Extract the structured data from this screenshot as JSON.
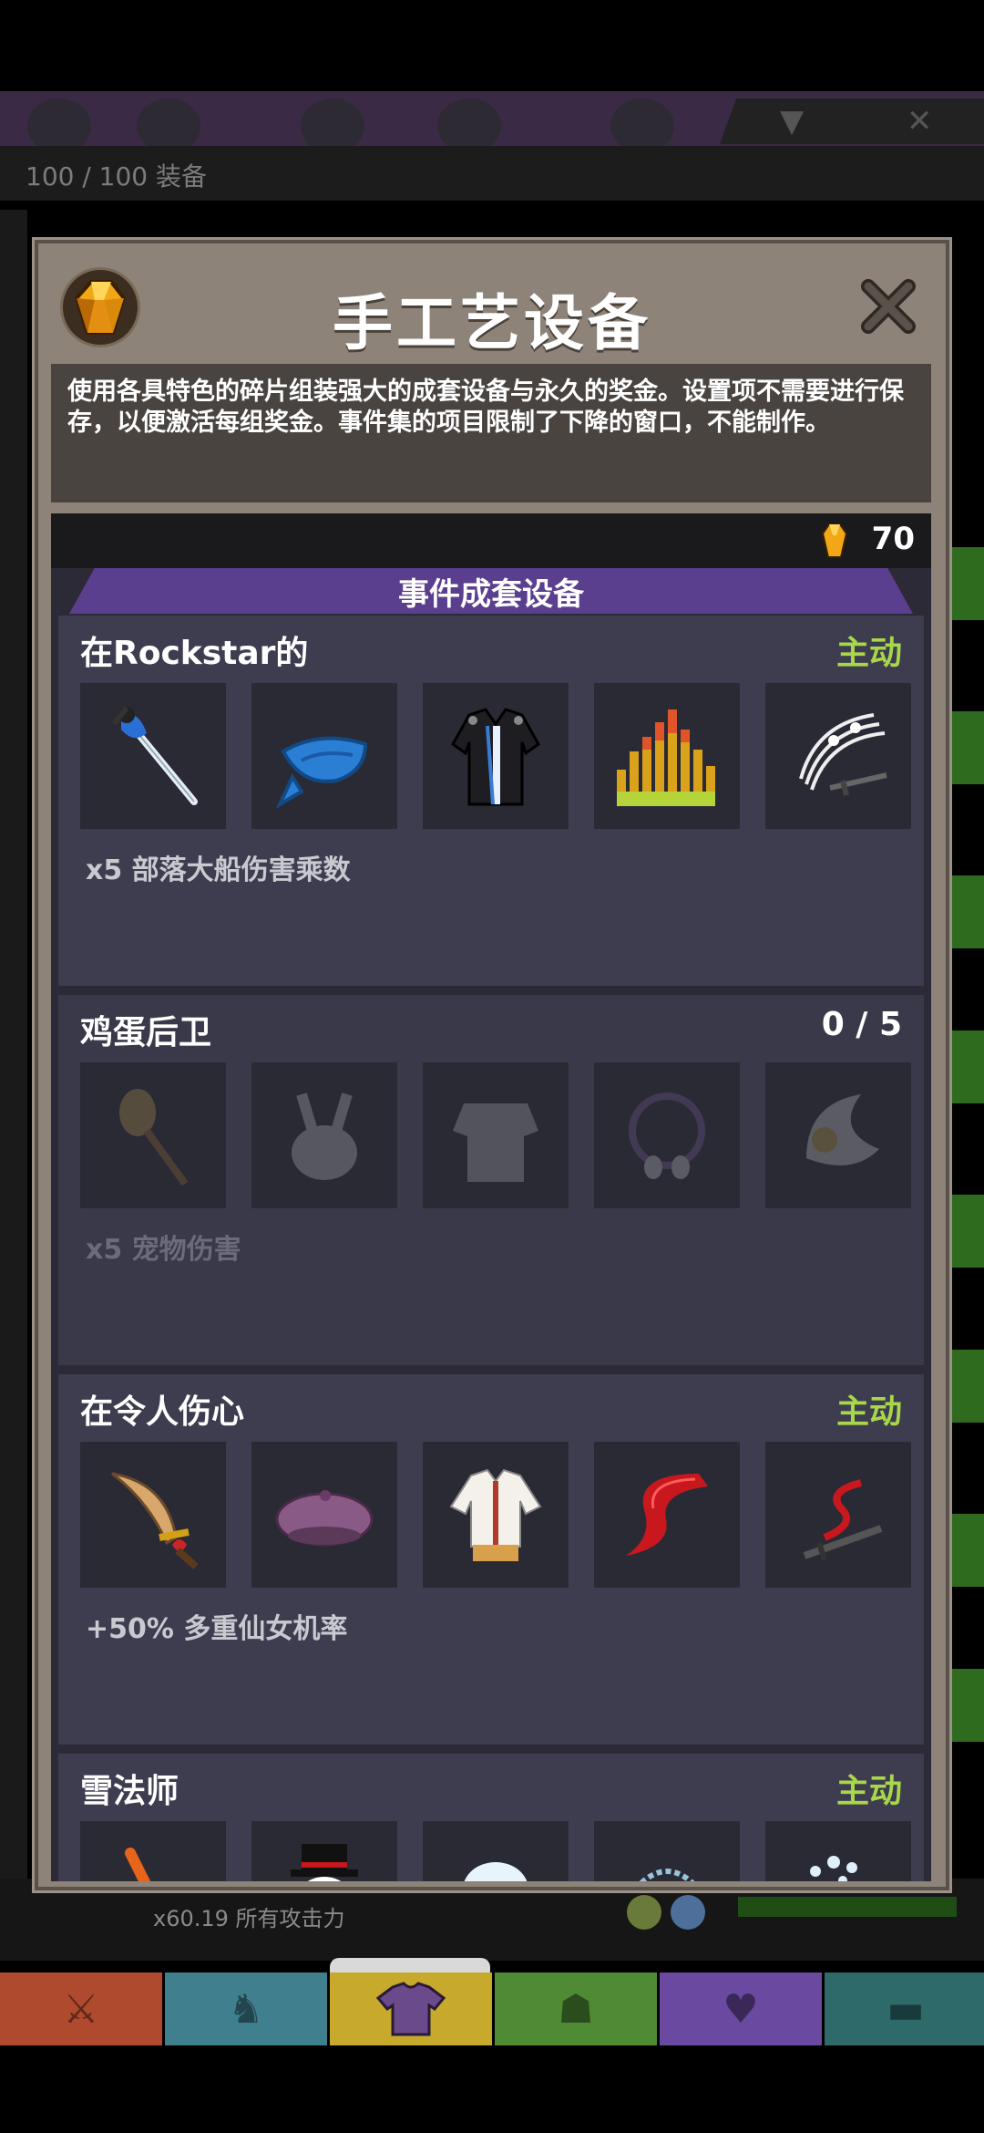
{
  "background": {
    "equipment_count": "100 / 100 装备",
    "stat_line": "x60.19 所有攻击力"
  },
  "modal": {
    "title": "手工艺设备",
    "description": "使用各具特色的碎片组装强大的成套设备与永久的奖金。设置项不需要进行保存，以便激活每组奖金。事件集的项目限制了下降的窗口，不能制作。",
    "currency_amount": "70",
    "section_title": "事件成套设备",
    "sets": [
      {
        "name": "在Rockstar的",
        "status": "主动",
        "bonus": "x5 部落大船伤害乘数",
        "items": [
          "guitar-sword-icon",
          "blue-bandana-icon",
          "leather-jacket-icon",
          "equalizer-icon",
          "music-staff-blade-icon"
        ]
      },
      {
        "name": "鸡蛋后卫",
        "status": "0 / 5",
        "bonus": "x5 宠物伤害",
        "items": [
          "egg-staff-icon",
          "bunny-helmet-icon",
          "chest-armor-icon",
          "egg-necklace-icon",
          "egg-axe-icon"
        ]
      },
      {
        "name": "在令人伤心",
        "status": "主动",
        "bonus": "+50% 多重仙女机率",
        "items": [
          "heart-sword-icon",
          "beret-icon",
          "white-jacket-icon",
          "red-ribbon-icon",
          "ribbon-blade-icon"
        ]
      },
      {
        "name": "雪法师",
        "status": "主动",
        "bonus": "",
        "items": [
          "carrot-staff-icon",
          "snowman-hat-icon",
          "snowball-icon",
          "frost-arc-icon",
          "snow-crystals-icon"
        ]
      }
    ]
  },
  "colors": {
    "active": "#a8d84a",
    "banner": "#5b3f8f",
    "modal_frame": "#8d8378",
    "card": "#3e3d50"
  },
  "nav": {
    "tabs": [
      "sword-tab-icon",
      "helmet-tab-icon",
      "shirt-tab-icon",
      "pet-tab-icon",
      "heart-tab-icon",
      "chest-tab-icon"
    ]
  }
}
